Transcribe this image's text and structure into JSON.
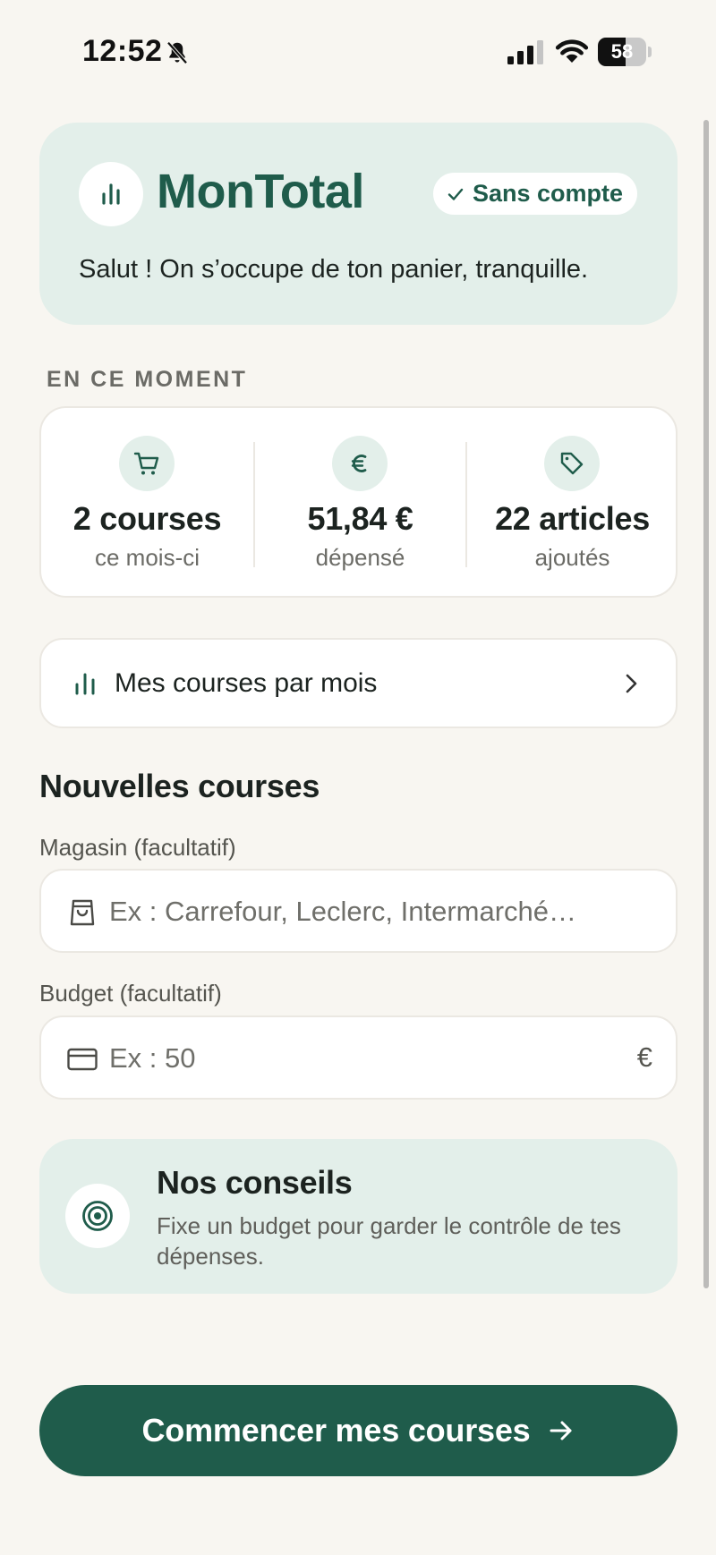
{
  "status_bar": {
    "time": "12:52",
    "battery_level": "58",
    "battery_percent": 58,
    "icons": [
      "bell-slash-icon",
      "cellular-signal-icon",
      "wifi-icon",
      "battery-icon"
    ]
  },
  "header": {
    "brand": "MonTotal",
    "badge": "Sans compte",
    "subtitle": "Salut ! On s’occupe de ton panier, tranquille."
  },
  "summary": {
    "section_label": "EN CE MOMENT",
    "stats": [
      {
        "icon": "cart-icon",
        "value": "2 courses",
        "caption": "ce mois-ci"
      },
      {
        "icon": "euro-icon",
        "value": "51,84 €",
        "caption": "dépensé"
      },
      {
        "icon": "tag-icon",
        "value": "22 articles",
        "caption": "ajoutés"
      }
    ]
  },
  "monthly_link": {
    "label": "Mes courses par mois",
    "icon": "bar-chart-icon"
  },
  "form": {
    "title": "Nouvelles courses",
    "store": {
      "label": "Magasin (facultatif)",
      "placeholder": "Ex : Carrefour, Leclerc, Intermarché…",
      "value": "",
      "icon": "shopping-bag-icon"
    },
    "budget": {
      "label": "Budget (facultatif)",
      "placeholder": "Ex : 50",
      "value": "",
      "suffix": "€",
      "icon": "credit-card-icon"
    }
  },
  "tip": {
    "title": "Nos conseils",
    "text": "Fixe un budget pour garder le contrôle de tes dépenses.",
    "icon": "target-icon"
  },
  "cta": {
    "label": "Commencer mes courses",
    "icon": "arrow-right-icon"
  },
  "colors": {
    "accent": "#1f5c4b",
    "accent_tint": "#e3efea",
    "background": "#f8f6f1"
  }
}
